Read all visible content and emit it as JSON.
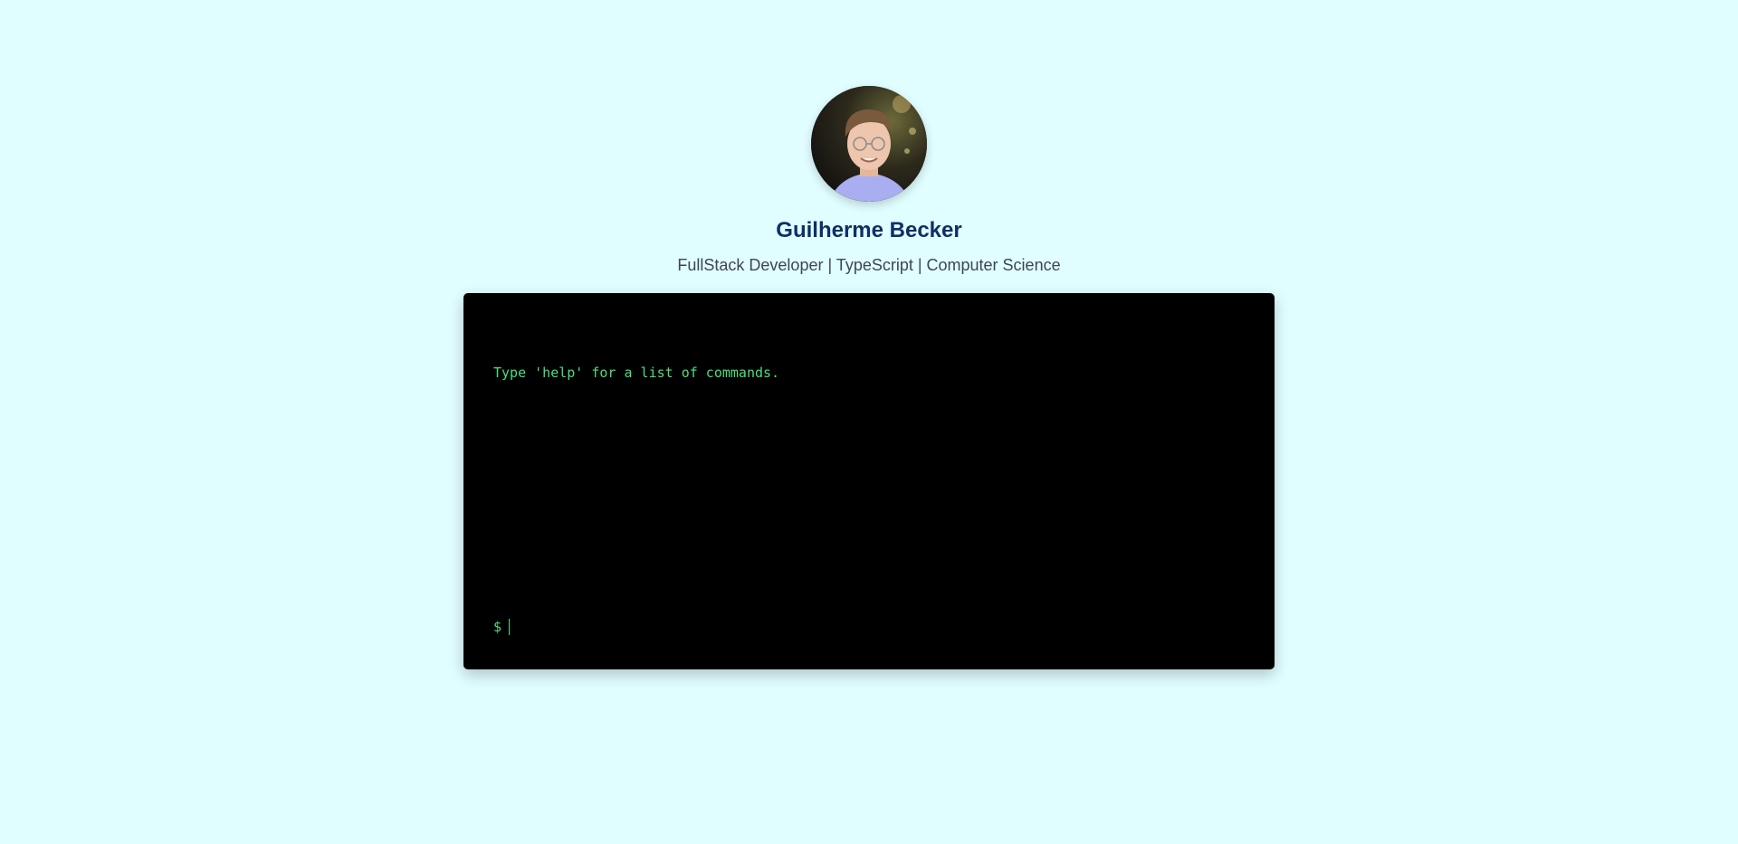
{
  "profile": {
    "name": "Guilherme Becker",
    "subtitle": "FullStack Developer | TypeScript | Computer Science"
  },
  "terminal": {
    "output_lines": [
      "Type 'help' for a list of commands."
    ],
    "prompt": "$",
    "input_value": "",
    "text_color": "#4ade80",
    "background": "#000000"
  },
  "colors": {
    "page_background": "#e0fdff",
    "name": "#0f2f66",
    "subtitle": "#3f4652"
  }
}
